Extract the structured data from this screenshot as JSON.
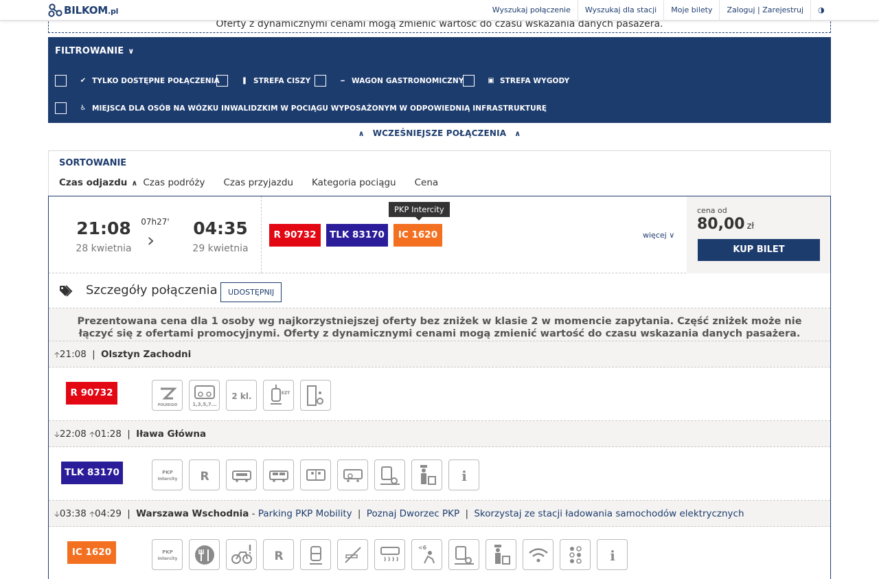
{
  "header": {
    "logo_text": "BILKOM",
    "logo_suffix": ".pl",
    "nav": [
      "Wyszukaj połączenie",
      "Wyszukaj dla stacji",
      "Moje bilety",
      "Zaloguj | Zarejestruj"
    ],
    "contrast_icon": "◑"
  },
  "notice_top": "Oferty z dynamicznymi cenami mogą zmienić wartość do czasu wskazania danych pasażera.",
  "filter": {
    "title": "FILTROWANIE",
    "options": [
      "TYLKO DOSTĘPNE POŁĄCZENIA",
      "STREFA CISZY",
      "WAGON GASTRONOMICZNY",
      "STREFA WYGODY",
      "MIEJSCA DLA OSÓB NA WÓZKU INWALIDZKIM W POCIĄGU WYPOSAŻONYM W ODPOWIEDNIĄ INFRASTRUKTURĘ"
    ],
    "option_icons": [
      "✔",
      "🎐",
      "🍴",
      "💼",
      "♿"
    ]
  },
  "earlier": "WCZEŚNIEJSZE POŁĄCZENIA",
  "sorting": {
    "title": "SORTOWANIE",
    "options": [
      "Czas odjazdu",
      "Czas podróży",
      "Czas przyjazdu",
      "Kategoria pociągu",
      "Cena"
    ],
    "active": "Czas odjazdu"
  },
  "connection": {
    "departure_time": "21:08",
    "departure_date": "28 kwietnia",
    "duration": "07h27'",
    "arrival_time": "04:35",
    "arrival_date": "29 kwietnia",
    "trains": [
      {
        "label": "R 90732",
        "color": "#e30613"
      },
      {
        "label": "TLK 83170",
        "color": "#2b1d9a"
      },
      {
        "label": "IC 1620",
        "color": "#f37021"
      }
    ],
    "tooltip": "PKP Intercity",
    "more": "więcej",
    "price_label": "cena od",
    "price": "80,00",
    "currency": "zł",
    "buy": "KUP BILET"
  },
  "details": {
    "title": "Szczegóły połączenia",
    "share": "UDOSTĘPNIJ",
    "disclaimer": "Prezentowana cena dla 1 osoby wg najkorzystniejszej oferty bez zniżek w klasie 2 w momencie zapytania. Część zniżek może nie łączyć się z ofertami promocyjnymi. Oferty z dynamicznymi cenami mogą zmienić wartość do czasu wskazania danych pasażera."
  },
  "stops": [
    {
      "dep": "21:08",
      "sep": "|",
      "name": "Olsztyn Zachodni"
    },
    {
      "arr": "22:08",
      "dep": "01:28",
      "sep": "|",
      "name": "Iława Główna"
    },
    {
      "arr": "03:38",
      "dep": "04:29",
      "sep": "|",
      "name": "Warszawa Wschodnia",
      "dash": "-",
      "links": [
        "Parking PKP Mobility",
        "Poznaj Dworzec PKP",
        "Skorzystaj ze stacji ładowania samochodów elektrycznych"
      ]
    }
  ],
  "train_rows": [
    {
      "label": "R 90732",
      "color": "#e30613",
      "icons": [
        "polregio-logo-icon",
        "bike-transport-icon",
        "class-2-icon",
        "ezt-train-icon",
        "wheelchair-door-icon"
      ],
      "icon_texts": {
        "bike": "1,3,5,7...",
        "class": "2 kl.",
        "ezt": "EZT",
        "polregio": "POLREGIO"
      }
    },
    {
      "label": "TLK 83170",
      "color": "#2b1d9a",
      "icons": [
        "pkp-intercity-logo-icon",
        "reservation-icon",
        "couchette-icon",
        "sleeper-icon",
        "compartment-icon",
        "wheelchair-car-icon",
        "wheelchair-lift-icon",
        "conductor-luggage-icon",
        "info-icon"
      ],
      "icon_texts": {
        "pkp": "PKP",
        "intercity": "Intercity",
        "r": "R",
        "i": "i"
      }
    },
    {
      "label": "IC 1620",
      "color": "#f37021",
      "icons": [
        "pkp-intercity-logo-icon",
        "restaurant-icon",
        "bike-warning-icon",
        "reservation-icon",
        "train-icon",
        "no-smoking-icon",
        "air-conditioning-icon",
        "child-seat-icon",
        "wheelchair-lift-icon",
        "conductor-luggage-icon",
        "wifi-icon",
        "braille-icon",
        "info-icon"
      ],
      "icon_texts": {
        "pkp": "PKP",
        "intercity": "Intercity",
        "r": "R",
        "i": "i",
        "kids": "<6"
      }
    }
  ]
}
